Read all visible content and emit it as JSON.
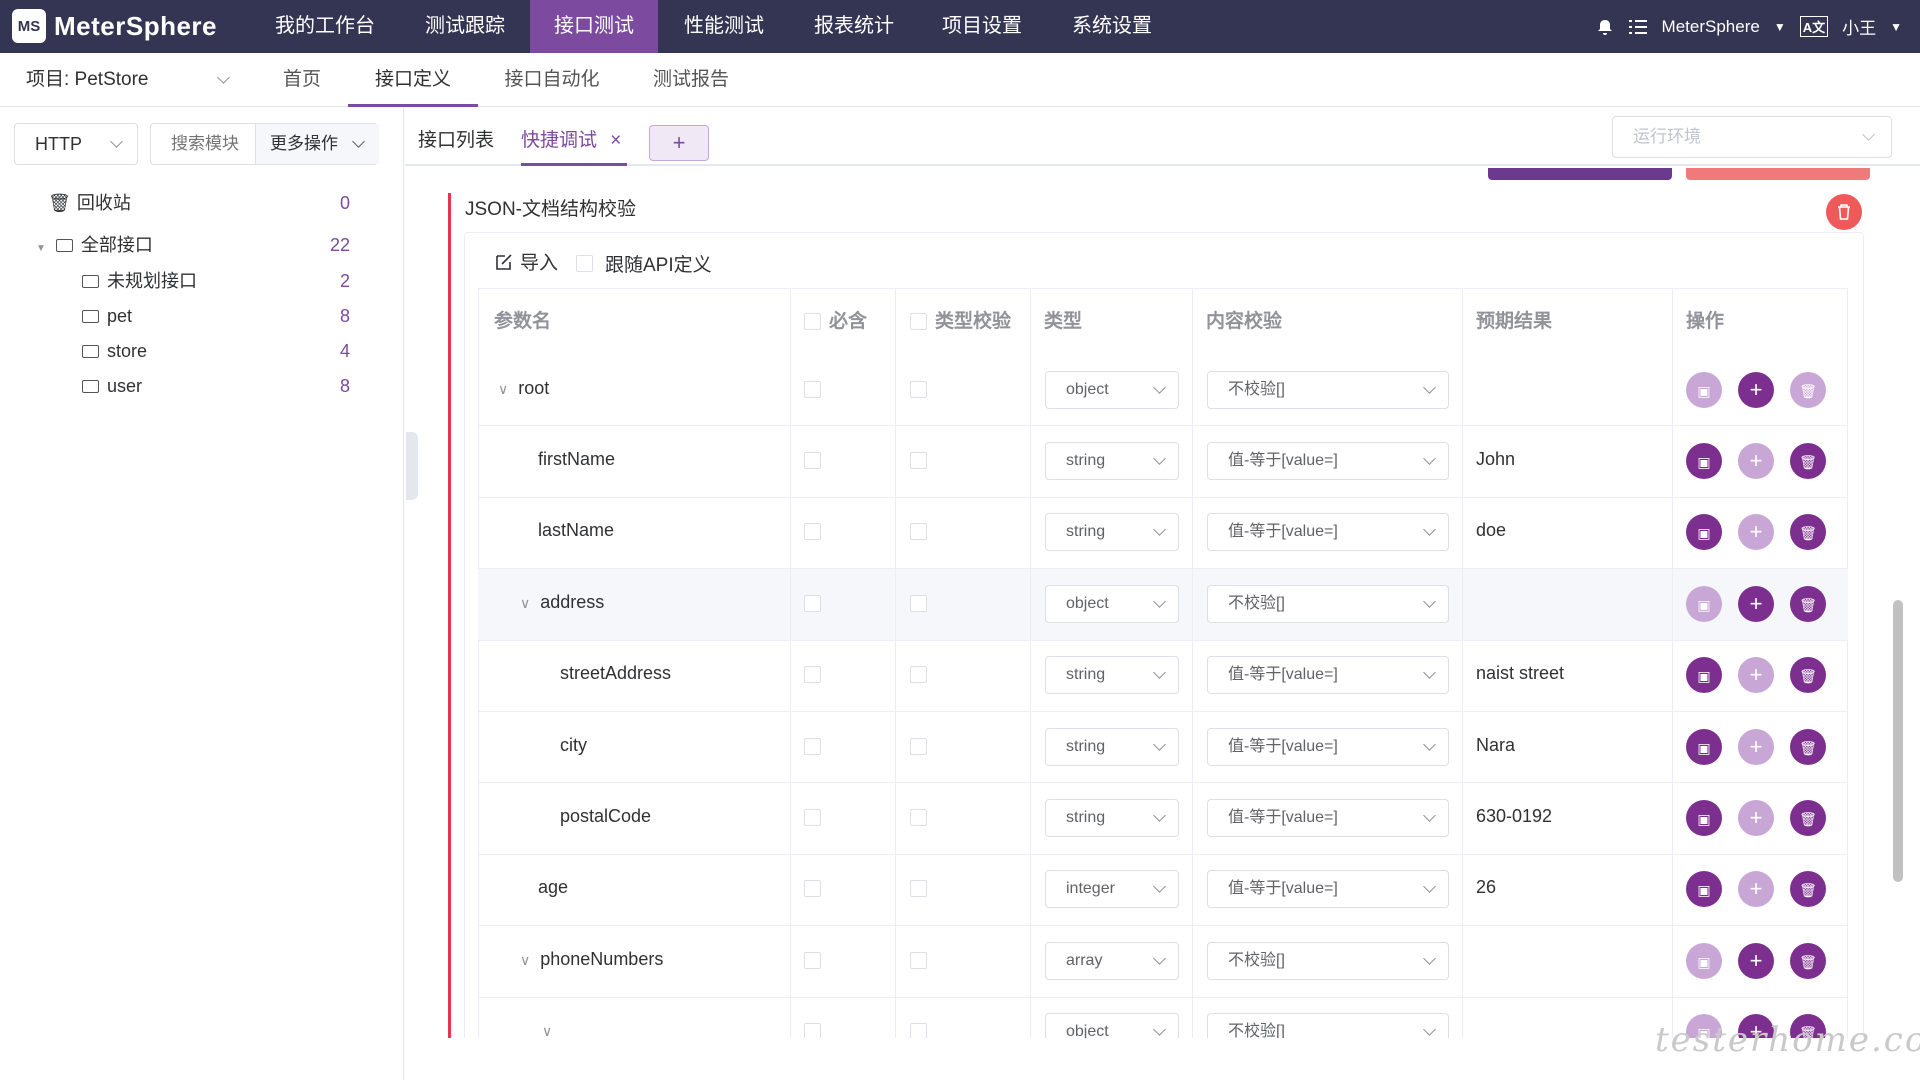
{
  "app": {
    "logo_mark": "MS",
    "logo_text": "MeterSphere"
  },
  "topnav": {
    "items": [
      "我的工作台",
      "测试跟踪",
      "接口测试",
      "性能测试",
      "报表统计",
      "项目设置",
      "系统设置"
    ],
    "active_index": 2,
    "workspace": "MeterSphere",
    "lang_label": "A文",
    "user": "小王"
  },
  "subnav": {
    "project_label": "项目: PetStore",
    "items": [
      "首页",
      "接口定义",
      "接口自动化",
      "测试报告"
    ],
    "active_index": 1
  },
  "left": {
    "protocol": "HTTP",
    "search_placeholder": "搜索模块",
    "more_ops": "更多操作",
    "tree": [
      {
        "label": "回收站",
        "count": "0"
      },
      {
        "label": "全部接口",
        "count": "22"
      },
      {
        "label": "未规划接口",
        "count": "2"
      },
      {
        "label": "pet",
        "count": "8"
      },
      {
        "label": "store",
        "count": "4"
      },
      {
        "label": "user",
        "count": "8"
      }
    ]
  },
  "tabs": {
    "items": [
      "接口列表",
      "快捷调试"
    ],
    "close": "×",
    "add": "+",
    "env_placeholder": "运行环境"
  },
  "section": {
    "title": "JSON-文档结构校验",
    "import_label": "导入",
    "follow_api_label": "跟随API定义"
  },
  "table": {
    "headers": [
      "参数名",
      "必含",
      "类型校验",
      "类型",
      "内容校验",
      "预期结果",
      "操作"
    ],
    "rows": [
      {
        "name": "root",
        "expand": "∨",
        "type": "object",
        "check": "不校验[]",
        "expected": ""
      },
      {
        "name": "firstName",
        "expand": "",
        "type": "string",
        "check": "值-等于[value=]",
        "expected": "John"
      },
      {
        "name": "lastName",
        "expand": "",
        "type": "string",
        "check": "值-等于[value=]",
        "expected": "doe"
      },
      {
        "name": "address",
        "expand": "∨",
        "type": "object",
        "check": "不校验[]",
        "expected": ""
      },
      {
        "name": "streetAddress",
        "expand": "",
        "type": "string",
        "check": "值-等于[value=]",
        "expected": "naist street"
      },
      {
        "name": "city",
        "expand": "",
        "type": "string",
        "check": "值-等于[value=]",
        "expected": "Nara"
      },
      {
        "name": "postalCode",
        "expand": "",
        "type": "string",
        "check": "值-等于[value=]",
        "expected": "630-0192"
      },
      {
        "name": "age",
        "expand": "",
        "type": "integer",
        "check": "值-等于[value=]",
        "expected": "26"
      },
      {
        "name": "phoneNumbers",
        "expand": "∨",
        "type": "array",
        "check": "不校验[]",
        "expected": ""
      },
      {
        "name": "",
        "expand": "∨",
        "type": "object",
        "check": "不校验[]",
        "expected": ""
      }
    ]
  },
  "watermark": "testerhome.com",
  "colors": {
    "nav_bg": "#333553",
    "accent": "#7c4a9e",
    "danger": "#e8344e"
  }
}
